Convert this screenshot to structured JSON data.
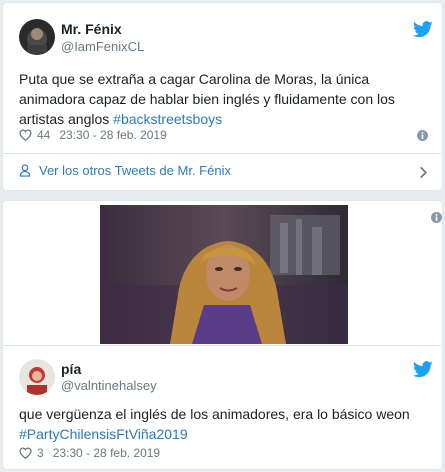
{
  "tweet1": {
    "author_name": "Mr. Fénix",
    "author_handle": "@IamFenixCL",
    "text_before": "Puta que se extraña a cagar Carolina de Moras, la única animadora capaz de hablar bien inglés y fluidamente con los artistas anglos ",
    "hashtag": "#backstreetsboys",
    "likes": "44",
    "timestamp": "23:30 - 28 feb. 2019",
    "more_tweets_label": "Ver los otros Tweets de Mr. Fénix"
  },
  "tweet2": {
    "author_name": "pía",
    "author_handle": "@valntinehalsey",
    "text_before": "que vergüenza el inglés de los animadores, era lo básico weon ",
    "hashtag": "#PartyChilensisFtViña2019",
    "likes": "3",
    "timestamp": "23:30 - 28 feb. 2019"
  },
  "colors": {
    "link": "#2b7bb9",
    "twitter_blue": "#1da1f2",
    "meta_gray": "#697882",
    "border": "#e1e8ed"
  },
  "icons": {
    "brand": "twitter-bird-icon",
    "like": "heart-icon",
    "info": "info-icon",
    "profile": "person-icon",
    "navigate": "chevron-right-icon"
  }
}
